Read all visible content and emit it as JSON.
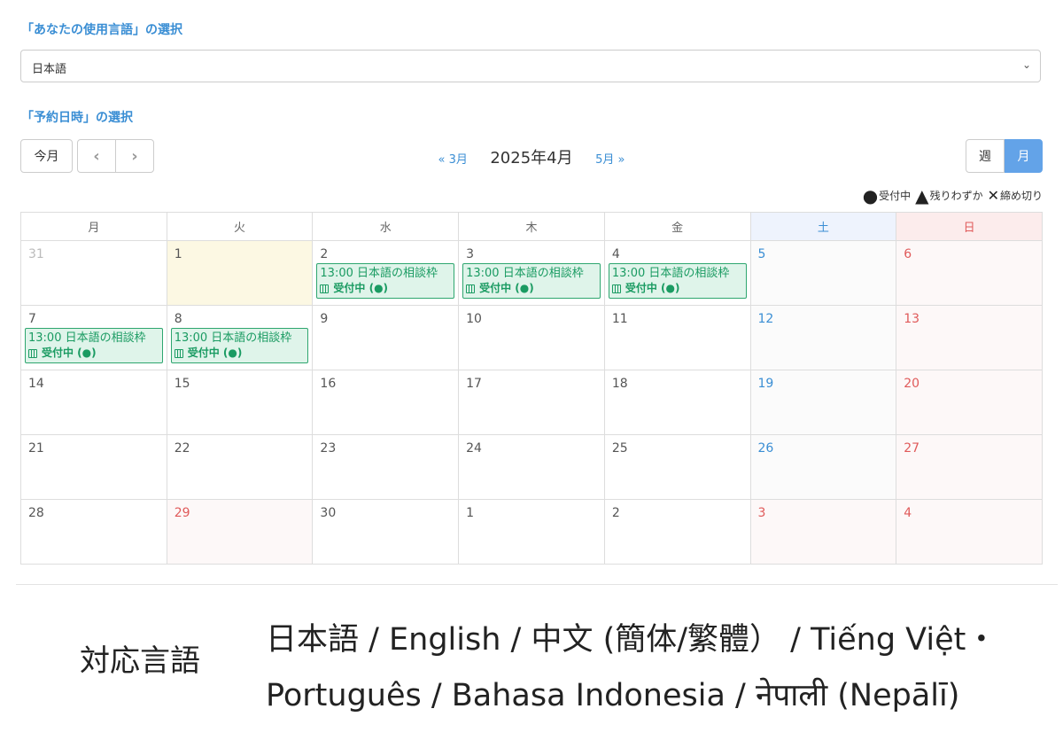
{
  "language_section": {
    "label": "「あなたの使用言語」の選択",
    "selected": "日本語"
  },
  "reservation_section": {
    "label": "「予約日時」の選択"
  },
  "toolbar": {
    "today_label": "今月",
    "prev_icon": "chevron-left",
    "next_icon": "chevron-right",
    "prev_month_link": "« 3月",
    "title": "2025年4月",
    "next_month_link": "5月 »",
    "view_week": "週",
    "view_month": "月",
    "active_view": "月"
  },
  "legend": [
    {
      "symbol": "●",
      "label": "受付中"
    },
    {
      "symbol": "▲",
      "label": "残りわずか"
    },
    {
      "symbol": "✕",
      "label": "締め切り"
    }
  ],
  "calendar": {
    "weekdays": [
      "月",
      "火",
      "水",
      "木",
      "金",
      "土",
      "日"
    ],
    "weeks": [
      [
        "31",
        "1",
        "2",
        "3",
        "4",
        "5",
        "6"
      ],
      [
        "7",
        "8",
        "9",
        "10",
        "11",
        "12",
        "13"
      ],
      [
        "14",
        "15",
        "16",
        "17",
        "18",
        "19",
        "20"
      ],
      [
        "21",
        "22",
        "23",
        "24",
        "25",
        "26",
        "27"
      ],
      [
        "28",
        "29",
        "30",
        "1",
        "2",
        "3",
        "4"
      ]
    ],
    "event_title": "13:00 日本語の相談枠",
    "event_status": "受付中 (●)",
    "colors": {
      "accent": "#3a8ed4",
      "event_border": "#2ea66f",
      "event_bg": "#dff4ea",
      "today_bg": "#fcf8e3",
      "sunday": "#e05a5a"
    }
  },
  "footer": {
    "label": "対応言語",
    "line1": "日本語 / English / 中文 (簡体/繁體）  / Tiếng Việt・",
    "line2": "Português / Bahasa Indonesia / नेपाली (Nepālī)"
  }
}
